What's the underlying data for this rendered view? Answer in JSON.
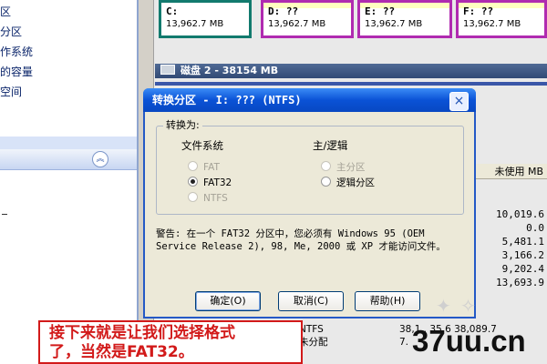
{
  "left_panel": {
    "items": [
      {
        "label": "区"
      },
      {
        "label": "分区"
      },
      {
        "label": "作系统"
      },
      {
        "label": "的容量"
      },
      {
        "label": "空间"
      }
    ]
  },
  "partitions": [
    {
      "letter": "C:",
      "size": "13,962.7 MB"
    },
    {
      "letter": "D: ??",
      "size": "13,962.7 MB"
    },
    {
      "letter": "E: ??",
      "size": "13,962.7 MB"
    },
    {
      "letter": "F: ??",
      "size": "13,962.7 MB"
    }
  ],
  "disk_bar": {
    "label": "磁盘 2 - 38154 MB"
  },
  "table": {
    "header": "未使用 MB",
    "free_values": [
      "10,019.6",
      "0.0",
      "5,481.1",
      "3,166.2",
      "9,202.4",
      "13,693.9"
    ],
    "rows": [
      {
        "fs": "NTFS",
        "rest": "38,1..  35.6   38,089.7"
      },
      {
        "fs": "未分配",
        "rest": "7."
      }
    ]
  },
  "dialog": {
    "title": "转换分区 - I: ??? (NTFS)",
    "close_symbol": "×",
    "group_label": "转换为:",
    "fs_header": "文件系统",
    "type_header": "主/逻辑",
    "fs_options": [
      {
        "label": "FAT",
        "checked": false,
        "disabled": true
      },
      {
        "label": "FAT32",
        "checked": true,
        "disabled": false
      },
      {
        "label": "NTFS",
        "checked": false,
        "disabled": true
      }
    ],
    "type_options": [
      {
        "label": "主分区",
        "checked": false,
        "disabled": true
      },
      {
        "label": "逻辑分区",
        "checked": false,
        "disabled": false
      }
    ],
    "warning_line1": "警告: 在一个 FAT32 分区中，您必须有 Windows 95 (OEM",
    "warning_line2": "Service Release 2), 98, Me, 2000 或 XP 才能访问文件。",
    "ok_label": "确定(O)",
    "cancel_label": "取消(C)",
    "help_label": "帮助(H)"
  },
  "note": {
    "line1": "接下来就是让我们选择格式",
    "line2": "了，当然是FAT32。"
  },
  "watermark": "37uu.cn",
  "colors": {
    "title_bar": "#0a52d6",
    "note_red": "#d21a1a",
    "card_c_border": "#127a6e",
    "card_other_border": "#b02bb0"
  }
}
